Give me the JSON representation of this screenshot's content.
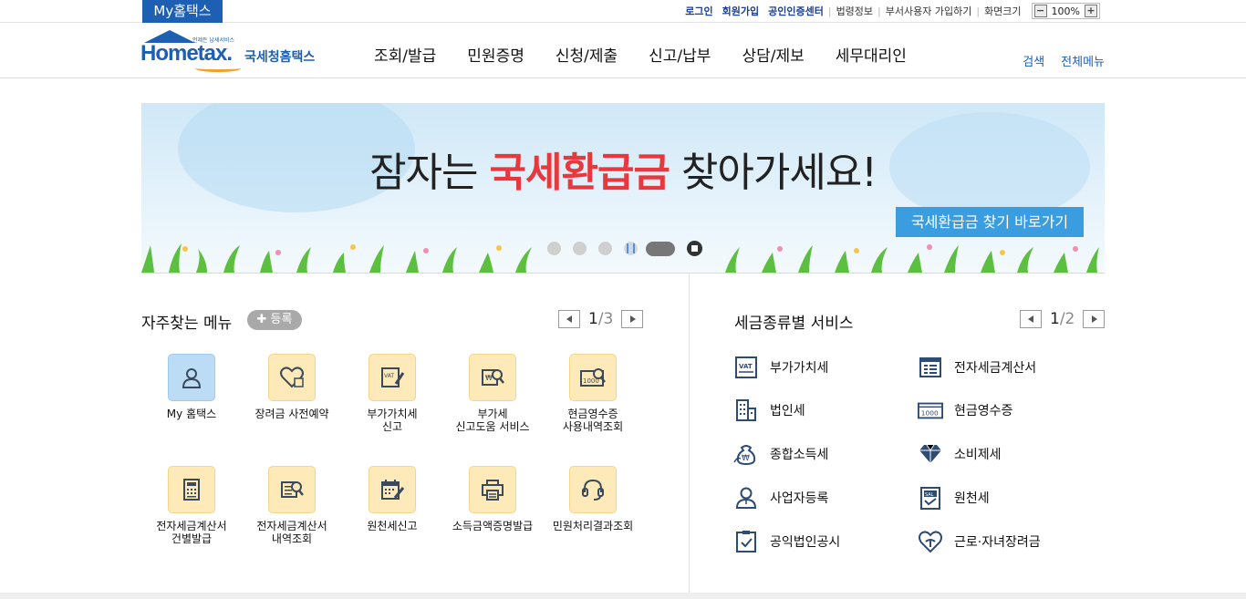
{
  "topbar": {
    "my_label": "My홈택스",
    "login": "로그인",
    "join": "회원가입",
    "cert": "공인인증센터",
    "law": "법령정보",
    "dept": "부서사용자 가입하기",
    "screen_size": "화면크기",
    "zoom_minus": "−",
    "zoom_value": "100%",
    "zoom_plus": "+"
  },
  "header": {
    "logo_main": "Hometax.",
    "logo_small": "언제든 납세서비스",
    "logo_kr": "국세청홈택스",
    "nav": [
      "조회/발급",
      "민원증명",
      "신청/제출",
      "신고/납부",
      "상담/제보",
      "세무대리인"
    ],
    "search": "검색",
    "all_menu": "전체메뉴"
  },
  "banner": {
    "title_pre": "잠자는 ",
    "title_hl": "국세환급금",
    "title_post": " 찾아가세요!",
    "button": "국세환급금 찾기 바로가기",
    "accent_color": "#e8383d",
    "button_color": "#3a9de0"
  },
  "favorites": {
    "title": "자주찾는 메뉴",
    "register": "✚ 등록",
    "page_current": "1",
    "page_total": "/3",
    "items": [
      {
        "label": "My 홈택스",
        "icon": "user-icon"
      },
      {
        "label": "장려금 사전예약",
        "icon": "heart-icon"
      },
      {
        "label": "부가가치세\n신고",
        "icon": "vat-edit-icon"
      },
      {
        "label": "부가세\n신고도움 서비스",
        "icon": "won-search-icon"
      },
      {
        "label": "현금영수증\n사용내역조회",
        "icon": "receipt-search-icon"
      },
      {
        "label": "전자세금계산서\n건별발급",
        "icon": "calculator-icon"
      },
      {
        "label": "전자세금계산서\n내역조회",
        "icon": "invoice-search-icon"
      },
      {
        "label": "원천세신고",
        "icon": "calendar-edit-icon"
      },
      {
        "label": "소득금액증명발급",
        "icon": "printer-icon"
      },
      {
        "label": "민원처리결과조회",
        "icon": "headset-icon"
      }
    ]
  },
  "services": {
    "title": "세금종류별 서비스",
    "page_current": "1",
    "page_total": "/2",
    "items": [
      {
        "label": "부가가치세",
        "icon": "vat-icon"
      },
      {
        "label": "전자세금계산서",
        "icon": "invoice-icon"
      },
      {
        "label": "법인세",
        "icon": "building-icon"
      },
      {
        "label": "현금영수증",
        "icon": "receipt-icon"
      },
      {
        "label": "종합소득세",
        "icon": "money-bag-icon"
      },
      {
        "label": "소비제세",
        "icon": "diamond-icon"
      },
      {
        "label": "사업자등록",
        "icon": "person-icon"
      },
      {
        "label": "원천세",
        "icon": "salary-doc-icon"
      },
      {
        "label": "공익법인공시",
        "icon": "clipboard-icon"
      },
      {
        "label": "근로·자녀장려금",
        "icon": "heart-hand-icon"
      }
    ]
  }
}
